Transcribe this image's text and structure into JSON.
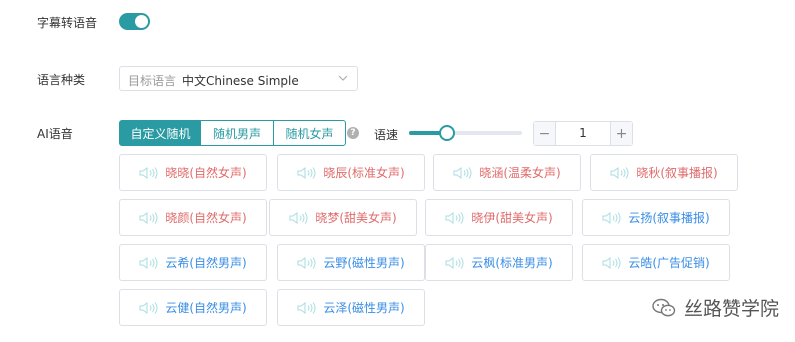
{
  "subtitle_tts": {
    "label": "字幕转语音",
    "enabled": true
  },
  "language": {
    "label": "语言种类",
    "prefix": "目标语言",
    "value": "中文Chinese Simple"
  },
  "ai_voice": {
    "label": "AI语音",
    "modes": [
      {
        "label": "自定义随机",
        "active": true
      },
      {
        "label": "随机男声",
        "active": false
      },
      {
        "label": "随机女声",
        "active": false
      }
    ],
    "help": "?",
    "speed": {
      "label": "语速",
      "value": "1",
      "minus": "−",
      "plus": "+"
    }
  },
  "voices": [
    {
      "label": "晓晓(自然女声)",
      "gender": "female"
    },
    {
      "label": "晓辰(标准女声)",
      "gender": "female"
    },
    {
      "label": "晓涵(温柔女声)",
      "gender": "female"
    },
    {
      "label": "晓秋(叙事播报)",
      "gender": "female"
    },
    {
      "label": "晓颜(自然女声)",
      "gender": "female"
    },
    {
      "label": "晓梦(甜美女声)",
      "gender": "female"
    },
    {
      "label": "晓伊(甜美女声)",
      "gender": "female"
    },
    {
      "label": "云扬(叙事播报)",
      "gender": "male"
    },
    {
      "label": "云希(自然男声)",
      "gender": "male"
    },
    {
      "label": "云野(磁性男声)",
      "gender": "male"
    },
    {
      "label": "云枫(标准男声)",
      "gender": "male"
    },
    {
      "label": "云皓(广告促销)",
      "gender": "male"
    },
    {
      "label": "云健(自然男声)",
      "gender": "male"
    },
    {
      "label": "云泽(磁性男声)",
      "gender": "male"
    }
  ],
  "watermark": {
    "text": "丝路赞学院"
  },
  "colors": {
    "accent": "#2a9ba3",
    "female": "#e06b6b",
    "male": "#3a8ee6"
  }
}
